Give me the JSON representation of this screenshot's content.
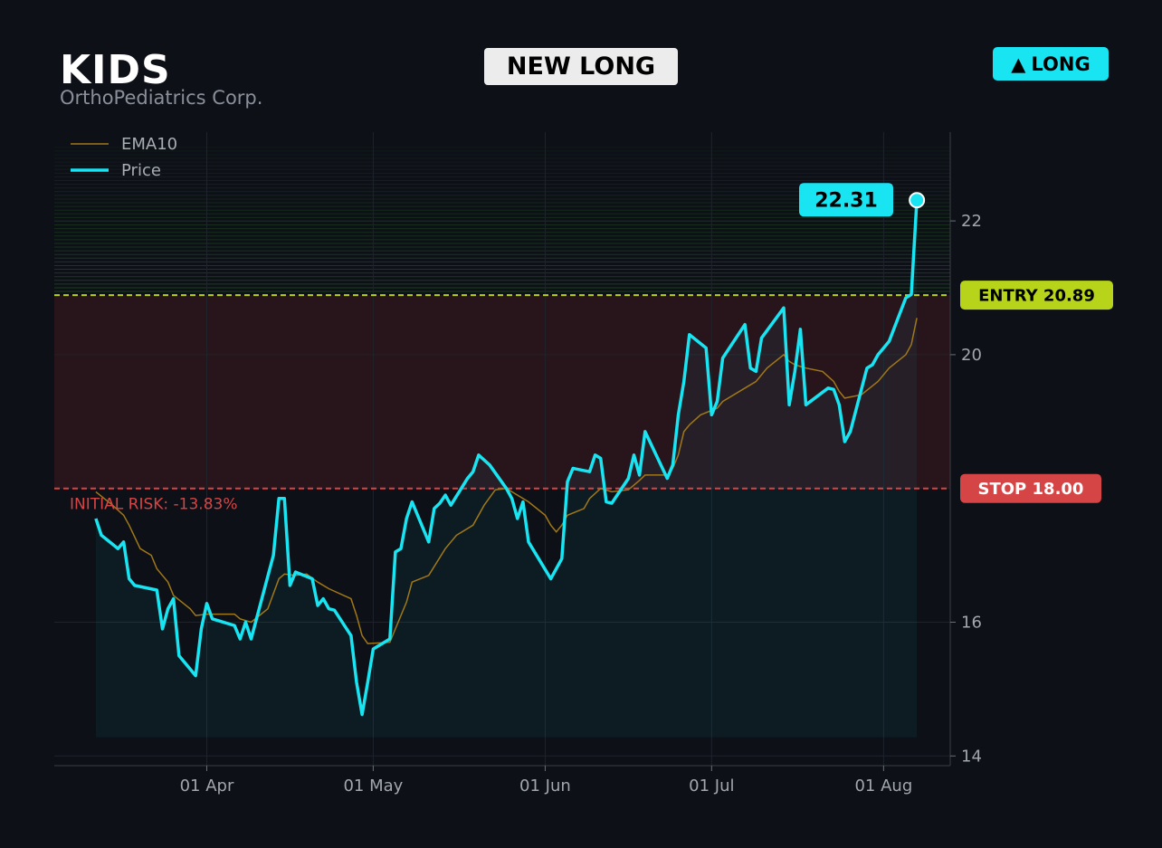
{
  "header": {
    "ticker": "KIDS",
    "company": "OrthoPediatrics Corp.",
    "signal": "NEW LONG",
    "direction_arrow": "▲",
    "direction_label": "LONG"
  },
  "colors": {
    "background": "#0d1017",
    "price": "#18e4f2",
    "ema": "#a07818",
    "entry": "#b8d41a",
    "stop": "#d64545",
    "profit_zone": "#1f4a1f",
    "risk_zone": "#2a151b"
  },
  "chart_data": {
    "type": "line",
    "x_ticks": [
      "01 Apr",
      "01 May",
      "01 Jun",
      "01 Jul",
      "01 Aug"
    ],
    "y_ticks": [
      14,
      16,
      20,
      22
    ],
    "ylim": [
      13.85,
      23.3
    ],
    "xlim_days": [
      -27,
      131
    ],
    "series": [
      {
        "name": "Price",
        "points": [
          [
            -20,
            17.55
          ],
          [
            -19,
            17.3
          ],
          [
            -16,
            17.1
          ],
          [
            -15,
            17.2
          ],
          [
            -14,
            16.65
          ],
          [
            -13,
            16.55
          ],
          [
            -9,
            16.48
          ],
          [
            -8,
            15.9
          ],
          [
            -7,
            16.2
          ],
          [
            -6,
            16.35
          ],
          [
            -5,
            15.5
          ],
          [
            -2,
            15.2
          ],
          [
            -1,
            15.9
          ],
          [
            0,
            16.28
          ],
          [
            1,
            16.05
          ],
          [
            5,
            15.95
          ],
          [
            6,
            15.75
          ],
          [
            7,
            16.0
          ],
          [
            8,
            15.75
          ],
          [
            12,
            17.0
          ],
          [
            13,
            17.85
          ],
          [
            14,
            17.85
          ],
          [
            15,
            16.55
          ],
          [
            16,
            16.75
          ],
          [
            19,
            16.65
          ],
          [
            20,
            16.25
          ],
          [
            21,
            16.35
          ],
          [
            22,
            16.2
          ],
          [
            23,
            16.18
          ],
          [
            26,
            15.8
          ],
          [
            27,
            15.1
          ],
          [
            28,
            14.62
          ],
          [
            29,
            15.1
          ],
          [
            30,
            15.6
          ],
          [
            33,
            15.75
          ],
          [
            34,
            17.05
          ],
          [
            35,
            17.1
          ],
          [
            36,
            17.55
          ],
          [
            37,
            17.8
          ],
          [
            40,
            17.2
          ],
          [
            41,
            17.7
          ],
          [
            42,
            17.78
          ],
          [
            43,
            17.9
          ],
          [
            44,
            17.75
          ],
          [
            47,
            18.15
          ],
          [
            48,
            18.25
          ],
          [
            49,
            18.5
          ],
          [
            51,
            18.35
          ],
          [
            54,
            18.0
          ],
          [
            55,
            17.85
          ],
          [
            56,
            17.55
          ],
          [
            57,
            17.8
          ],
          [
            58,
            17.2
          ],
          [
            62,
            16.65
          ],
          [
            63,
            16.8
          ],
          [
            64,
            16.95
          ],
          [
            65,
            18.1
          ],
          [
            66,
            18.3
          ],
          [
            69,
            18.25
          ],
          [
            70,
            18.5
          ],
          [
            71,
            18.45
          ],
          [
            72,
            17.8
          ],
          [
            73,
            17.78
          ],
          [
            76,
            18.15
          ],
          [
            77,
            18.5
          ],
          [
            78,
            18.2
          ],
          [
            79,
            18.85
          ],
          [
            83,
            18.15
          ],
          [
            84,
            18.35
          ],
          [
            85,
            19.1
          ],
          [
            86,
            19.6
          ],
          [
            87,
            20.3
          ],
          [
            90,
            20.1
          ],
          [
            91,
            19.1
          ],
          [
            92,
            19.3
          ],
          [
            93,
            19.95
          ],
          [
            97,
            20.45
          ],
          [
            98,
            19.8
          ],
          [
            99,
            19.75
          ],
          [
            100,
            20.25
          ],
          [
            104,
            20.7
          ],
          [
            105,
            19.25
          ],
          [
            106,
            19.75
          ],
          [
            107,
            20.38
          ],
          [
            108,
            19.25
          ],
          [
            112,
            19.5
          ],
          [
            113,
            19.48
          ],
          [
            114,
            19.25
          ],
          [
            115,
            18.7
          ],
          [
            116,
            18.85
          ],
          [
            119,
            19.8
          ],
          [
            120,
            19.85
          ],
          [
            121,
            20.0
          ],
          [
            122,
            20.1
          ],
          [
            123,
            20.2
          ],
          [
            126,
            20.85
          ],
          [
            127,
            20.9
          ],
          [
            128,
            22.31
          ]
        ]
      },
      {
        "name": "EMA10",
        "points": [
          [
            -20,
            17.95
          ],
          [
            -17,
            17.75
          ],
          [
            -15,
            17.6
          ],
          [
            -14,
            17.45
          ],
          [
            -12,
            17.1
          ],
          [
            -10,
            17.0
          ],
          [
            -9,
            16.8
          ],
          [
            -8,
            16.7
          ],
          [
            -7,
            16.6
          ],
          [
            -6,
            16.4
          ],
          [
            -3,
            16.2
          ],
          [
            -2,
            16.1
          ],
          [
            0,
            16.12
          ],
          [
            5,
            16.12
          ],
          [
            6,
            16.05
          ],
          [
            8,
            16.0
          ],
          [
            11,
            16.2
          ],
          [
            13,
            16.65
          ],
          [
            14,
            16.72
          ],
          [
            16,
            16.7
          ],
          [
            18,
            16.72
          ],
          [
            20,
            16.6
          ],
          [
            22,
            16.5
          ],
          [
            26,
            16.35
          ],
          [
            27,
            16.1
          ],
          [
            28,
            15.8
          ],
          [
            29,
            15.68
          ],
          [
            33,
            15.7
          ],
          [
            34,
            15.9
          ],
          [
            36,
            16.3
          ],
          [
            37,
            16.6
          ],
          [
            40,
            16.7
          ],
          [
            43,
            17.1
          ],
          [
            45,
            17.3
          ],
          [
            48,
            17.45
          ],
          [
            50,
            17.75
          ],
          [
            52,
            17.98
          ],
          [
            54,
            18.0
          ],
          [
            55,
            17.95
          ],
          [
            58,
            17.8
          ],
          [
            61,
            17.6
          ],
          [
            62,
            17.45
          ],
          [
            63,
            17.35
          ],
          [
            64,
            17.45
          ],
          [
            65,
            17.6
          ],
          [
            68,
            17.7
          ],
          [
            69,
            17.85
          ],
          [
            71,
            18.0
          ],
          [
            73,
            17.95
          ],
          [
            76,
            17.98
          ],
          [
            78,
            18.12
          ],
          [
            79,
            18.2
          ],
          [
            83,
            18.2
          ],
          [
            84,
            18.3
          ],
          [
            85,
            18.5
          ],
          [
            86,
            18.85
          ],
          [
            87,
            18.95
          ],
          [
            89,
            19.1
          ],
          [
            92,
            19.2
          ],
          [
            93,
            19.3
          ],
          [
            98,
            19.55
          ],
          [
            99,
            19.6
          ],
          [
            101,
            19.8
          ],
          [
            104,
            20.0
          ],
          [
            105,
            19.9
          ],
          [
            106,
            19.85
          ],
          [
            108,
            19.8
          ],
          [
            111,
            19.75
          ],
          [
            113,
            19.6
          ],
          [
            114,
            19.45
          ],
          [
            115,
            19.35
          ],
          [
            118,
            19.4
          ],
          [
            121,
            19.6
          ],
          [
            123,
            19.8
          ],
          [
            126,
            20.0
          ],
          [
            127,
            20.15
          ],
          [
            128,
            20.55
          ]
        ]
      }
    ],
    "levels": {
      "entry": 20.89,
      "stop": 18.0,
      "entry_label": "ENTRY 20.89",
      "stop_label": "STOP 18.00",
      "last_price": 22.31,
      "last_price_label": "22.31",
      "risk_text": "INITIAL RISK: -13.83%"
    },
    "legend": [
      {
        "name": "EMA10",
        "label": "EMA10"
      },
      {
        "name": "Price",
        "label": "Price"
      }
    ],
    "legend_position": "top-left",
    "grid": true
  }
}
